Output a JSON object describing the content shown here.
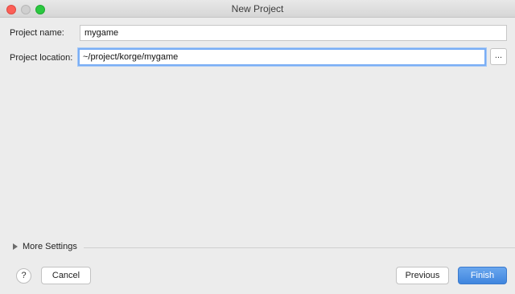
{
  "window": {
    "title": "New Project"
  },
  "form": {
    "name_label": "Project name:",
    "name_value": "mygame",
    "location_label": "Project location:",
    "location_value": "~/project/korge/mygame",
    "browse_label": "..."
  },
  "more_settings": {
    "label": "More Settings"
  },
  "footer": {
    "help_label": "?",
    "cancel_label": "Cancel",
    "previous_label": "Previous",
    "finish_label": "Finish"
  },
  "colors": {
    "accent": "#4a8fe7",
    "focus_ring": "#7aaef5",
    "close": "#fc5f57",
    "maximize": "#2bc840"
  }
}
